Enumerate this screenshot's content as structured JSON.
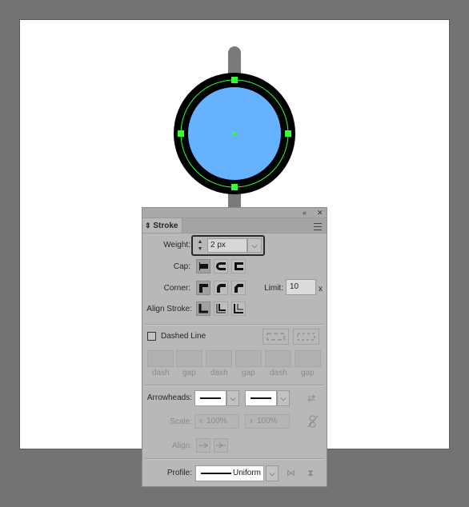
{
  "panel": {
    "title": "Stroke",
    "collapse_glyph": "«",
    "close_glyph": "✕",
    "tab_arrows": "⇕",
    "weight": {
      "label": "Weight:",
      "value": "2 px"
    },
    "cap": {
      "label": "Cap:"
    },
    "corner": {
      "label": "Corner:"
    },
    "limit": {
      "label": "Limit:",
      "value": "10",
      "suffix": "x"
    },
    "align_stroke": {
      "label": "Align Stroke:"
    },
    "dashed_line": {
      "label": "Dashed Line",
      "checked": false
    },
    "dash_labels": [
      "dash",
      "gap",
      "dash",
      "gap",
      "dash",
      "gap"
    ],
    "arrowheads": {
      "label": "Arrowheads:"
    },
    "scale": {
      "label": "Scale:",
      "start": "100%",
      "end": "100%"
    },
    "align": {
      "label": "Align:"
    },
    "profile": {
      "label": "Profile:",
      "value": "Uniform"
    }
  },
  "colors": {
    "canvas_bg": "#737373",
    "artboard": "#ffffff",
    "circle_fill": "#66b2ff",
    "circle_stroke": "#000000",
    "pole": "#7a7a7a",
    "selection": "#33ff33",
    "panel_bg": "#b8b8b8"
  },
  "icons": {
    "cap": [
      "butt-cap-icon",
      "round-cap-icon",
      "projecting-cap-icon"
    ],
    "corner": [
      "miter-join-icon",
      "round-join-icon",
      "bevel-join-icon"
    ],
    "align": [
      "align-center-icon",
      "align-inside-icon",
      "align-outside-icon"
    ]
  }
}
